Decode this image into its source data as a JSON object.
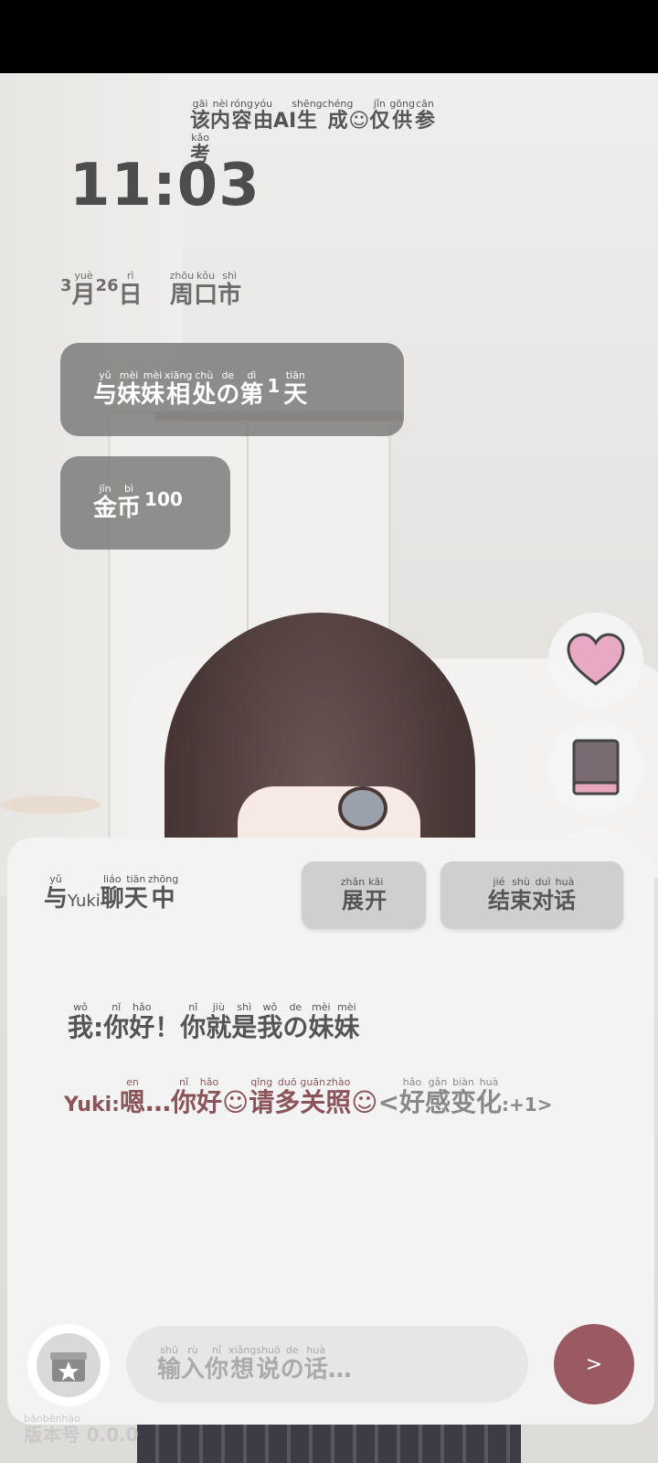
{
  "notice": {
    "segments": [
      {
        "t": "该",
        "p": "gāi"
      },
      {
        "t": "内",
        "p": "nèi"
      },
      {
        "t": "容",
        "p": "róng"
      },
      {
        "t": "由",
        "p": "yóu"
      },
      {
        "t": "AI",
        "p": ""
      },
      {
        "t": "生成",
        "p": "shēngchéng"
      },
      {
        "t": "☺",
        "p": ""
      },
      {
        "t": "仅",
        "p": "jǐn"
      },
      {
        "t": "供",
        "p": "gōng"
      },
      {
        "t": "参",
        "p": "cān"
      },
      {
        "t": "考",
        "p": "kǎo"
      }
    ]
  },
  "clock": "11:03",
  "date": {
    "month_num": "3",
    "month": "月",
    "month_py": "yuè",
    "day_num": "26",
    "day": "日",
    "day_py": "rì",
    "weekday": [
      {
        "t": "周",
        "p": "zhōu"
      },
      {
        "t": "口",
        "p": "kǒu"
      },
      {
        "t": "市",
        "p": "shì"
      }
    ]
  },
  "days_pill": {
    "before": [
      {
        "t": "与",
        "p": "yǔ"
      },
      {
        "t": "妹",
        "p": "mèi"
      },
      {
        "t": "妹",
        "p": "mèi"
      },
      {
        "t": "相",
        "p": "xiāng"
      },
      {
        "t": "处",
        "p": "chù"
      },
      {
        "t": "の",
        "p": "de"
      },
      {
        "t": "第",
        "p": "dì"
      }
    ],
    "number": "1",
    "after": [
      {
        "t": "天",
        "p": "tiān"
      }
    ]
  },
  "coins_pill": {
    "label": [
      {
        "t": "金",
        "p": "jīn"
      },
      {
        "t": "币",
        "p": "bì"
      }
    ],
    "value": "100"
  },
  "icons": {
    "heart": "heart-icon",
    "book": "book-icon",
    "gift": "gift-icon",
    "send": "send-icon"
  },
  "colors": {
    "heart": "#e7a9c4",
    "book": "#7a6c72",
    "send_bg": "#9a5a62",
    "reply_text": "#8a5459"
  },
  "panel": {
    "title_before": [
      {
        "t": "与",
        "p": "yǔ"
      }
    ],
    "title_name": "Yuki",
    "title_after": [
      {
        "t": "聊",
        "p": "liáo"
      },
      {
        "t": "天",
        "p": "tiān"
      },
      {
        "t": "中",
        "p": "zhōng"
      }
    ],
    "expand": [
      {
        "t": "展",
        "p": "zhǎn"
      },
      {
        "t": "开",
        "p": "kāi"
      }
    ],
    "end": [
      {
        "t": "结",
        "p": "jié"
      },
      {
        "t": "束",
        "p": "shù"
      },
      {
        "t": "对",
        "p": "duì"
      },
      {
        "t": "话",
        "p": "huà"
      }
    ]
  },
  "messages": {
    "user": [
      {
        "t": "我",
        "p": "wǒ"
      },
      {
        "t": ":",
        "p": ""
      },
      {
        "t": "你",
        "p": "nǐ"
      },
      {
        "t": "好",
        "p": "hǎo"
      },
      {
        "t": "！",
        "p": ""
      },
      {
        "t": "你",
        "p": "nǐ"
      },
      {
        "t": "就",
        "p": "jiù"
      },
      {
        "t": "是",
        "p": "shì"
      },
      {
        "t": "我",
        "p": "wǒ"
      },
      {
        "t": "の",
        "p": "de"
      },
      {
        "t": "妹",
        "p": "mèi"
      },
      {
        "t": "妹",
        "p": "mèi"
      }
    ],
    "reply_speaker": "Yuki:",
    "reply": [
      {
        "t": "嗯",
        "p": "en"
      },
      {
        "t": "…",
        "p": ""
      },
      {
        "t": "你",
        "p": "nǐ"
      },
      {
        "t": "好",
        "p": "hǎo"
      },
      {
        "t": "☺",
        "p": ""
      },
      {
        "t": "请",
        "p": "qǐng"
      },
      {
        "t": "多",
        "p": "duō"
      },
      {
        "t": "关",
        "p": "guān"
      },
      {
        "t": "照",
        "p": "zhào"
      },
      {
        "t": "☺",
        "p": ""
      }
    ],
    "affection": [
      {
        "t": "<",
        "p": ""
      },
      {
        "t": "好",
        "p": "hǎo"
      },
      {
        "t": "感",
        "p": "gǎn"
      },
      {
        "t": "变",
        "p": "biàn"
      },
      {
        "t": "化",
        "p": "huà"
      }
    ],
    "affection_delta": ":+1>"
  },
  "input": {
    "placeholder": [
      {
        "t": "输",
        "p": "shū"
      },
      {
        "t": "入",
        "p": "rù"
      },
      {
        "t": "你",
        "p": "nǐ"
      },
      {
        "t": "想",
        "p": "xiǎng"
      },
      {
        "t": "说",
        "p": "shuō"
      },
      {
        "t": "の",
        "p": "de"
      },
      {
        "t": "话",
        "p": "huà"
      },
      {
        "t": "…",
        "p": ""
      }
    ],
    "send_label": ">"
  },
  "footer": {
    "segments": [
      {
        "t": "版",
        "p": "bǎn"
      },
      {
        "t": "本",
        "p": "běn"
      },
      {
        "t": "号",
        "p": "hào"
      }
    ],
    "trail": "0.0.0"
  }
}
